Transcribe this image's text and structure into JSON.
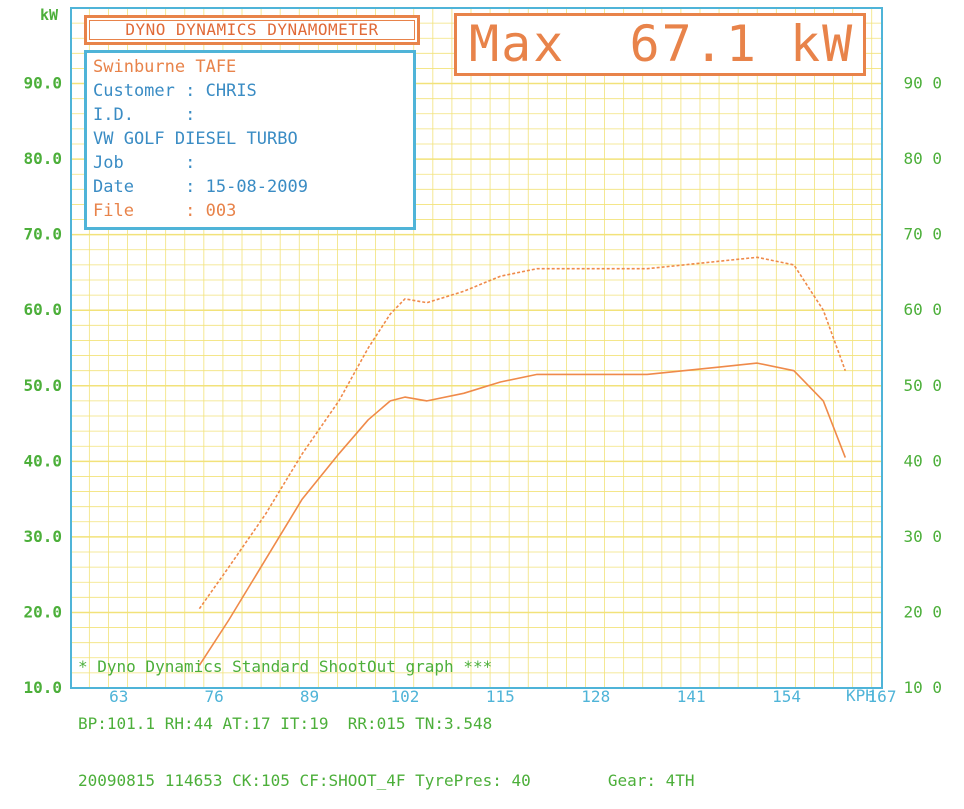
{
  "header": {
    "title": "DYNO DYNAMICS DYNAMOMETER",
    "max_label": "Max",
    "max_value": "67.1 kW"
  },
  "info": {
    "workshop": "Swinburne TAFE",
    "customer_label": "Customer",
    "customer_value": "CHRIS",
    "id_label": "I.D.",
    "id_value": "",
    "vehicle": "VW GOLF DIESEL TURBO",
    "job_label": "Job",
    "job_value": "",
    "date_label": "Date",
    "date_value": "15-08-2009",
    "file_label": "File",
    "file_value": "003"
  },
  "footer": {
    "line1": "* Dyno Dynamics Standard ShootOut graph ***",
    "line2": "BP:101.1 RH:44 AT:17 IT:19  RR:015 TN:3.548",
    "line3": "20090815 114653 CK:105 CF:SHOOT_4F TyrePres: 40",
    "gear": "Gear: 4TH"
  },
  "colors": {
    "grid": "#f2e27a",
    "frame": "#4fb4d8",
    "axis_text": "#4caf3a",
    "curve": "#ef8a4a",
    "accent": "#e8834a"
  },
  "chart_data": {
    "type": "line",
    "xlabel": "KPH",
    "ylabel": "kW",
    "xlim": [
      56.5,
      167
    ],
    "ylim": [
      10,
      100
    ],
    "x_ticks": [
      63,
      76,
      89,
      102,
      115,
      128,
      141,
      154,
      167
    ],
    "y_ticks_left": [
      "10.0",
      "20.0",
      "30.0",
      "40.0",
      "50.0",
      "60.0",
      "70.0",
      "80.0",
      "90.0"
    ],
    "y_ticks_right": [
      "10 0",
      "20 0",
      "30 0",
      "40 0",
      "50 0",
      "60 0",
      "70 0",
      "80 0",
      "90 0"
    ],
    "y_ticks_right_values": [
      10,
      20,
      30,
      40,
      50,
      60,
      70,
      80,
      90
    ],
    "grid": true,
    "series": [
      {
        "style": "dashed",
        "x": [
          74,
          78,
          83,
          88,
          93,
          97,
          100,
          102,
          105,
          110,
          115,
          120,
          125,
          130,
          135,
          140,
          145,
          150,
          155,
          159,
          162
        ],
        "y": [
          20.5,
          26,
          33,
          41,
          48,
          55,
          59.5,
          61.5,
          61,
          62.5,
          64.5,
          65.5,
          65.5,
          65.5,
          65.5,
          66,
          66.5,
          67,
          66,
          60,
          52
        ]
      },
      {
        "style": "solid",
        "x": [
          74,
          78,
          83,
          88,
          93,
          97,
          100,
          102,
          105,
          110,
          115,
          120,
          125,
          130,
          135,
          140,
          145,
          150,
          155,
          159,
          162
        ],
        "y": [
          13,
          19,
          27,
          35,
          41,
          45.5,
          48,
          48.5,
          48,
          49,
          50.5,
          51.5,
          51.5,
          51.5,
          51.5,
          52,
          52.5,
          53,
          52,
          48,
          40.5
        ]
      }
    ]
  }
}
